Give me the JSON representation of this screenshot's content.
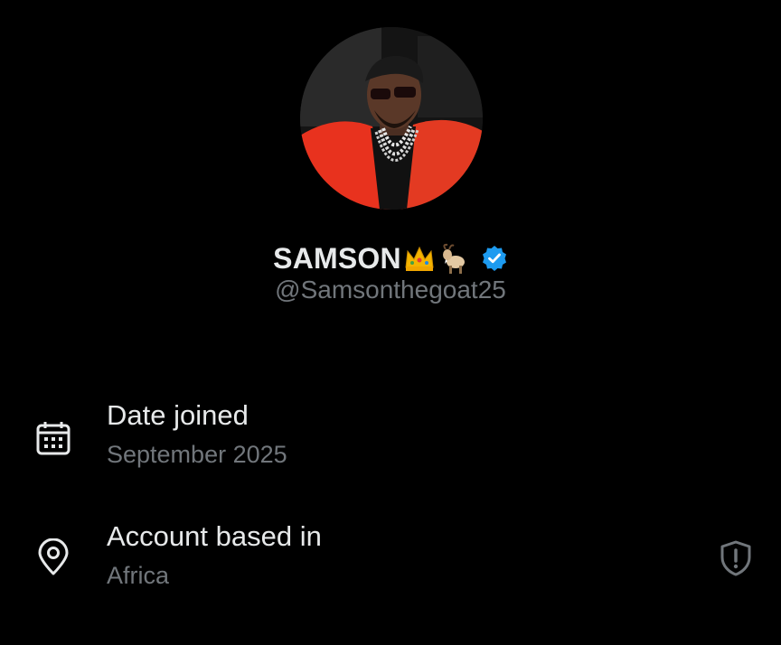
{
  "profile": {
    "display_name": "SAMSON",
    "name_emojis": [
      "crown-emoji",
      "goat-emoji"
    ],
    "verified": true,
    "handle": "@Samsonthegoat25"
  },
  "about": {
    "date_joined": {
      "label": "Date joined",
      "value": "September 2025",
      "icon": "calendar-icon"
    },
    "account_location": {
      "label": "Account based in",
      "value": "Africa",
      "icon": "location-pin-icon",
      "action_icon": "shield-alert-icon"
    }
  },
  "colors": {
    "background": "#000000",
    "primary_text": "#e7e9ea",
    "secondary_text": "#71767b",
    "verified_blue": "#1d9bf0"
  }
}
